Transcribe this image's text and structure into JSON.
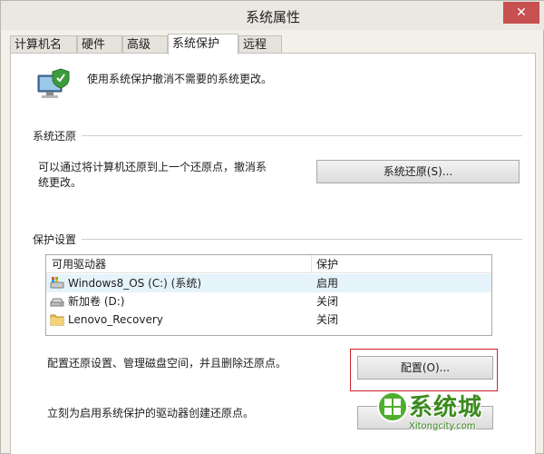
{
  "window": {
    "title": "系统属性",
    "close_glyph": "✕"
  },
  "tabs": [
    {
      "label": "计算机名"
    },
    {
      "label": "硬件"
    },
    {
      "label": "高级"
    },
    {
      "label": "系统保护",
      "active": true
    },
    {
      "label": "远程"
    }
  ],
  "intro": {
    "text": "使用系统保护撤消不需要的系统更改。",
    "icon": "computer-shield-icon"
  },
  "restore": {
    "group_title": "系统还原",
    "description_line1": "可以通过将计算机还原到上一个还原点，撤消系",
    "description_line2": "统更改。",
    "button_label": "系统还原(S)..."
  },
  "protection": {
    "group_title": "保护设置",
    "columns": [
      "可用驱动器",
      "保护"
    ],
    "drives": [
      {
        "name": "Windows8_OS (C:) (系统)",
        "status": "启用",
        "icon": "system-drive-icon",
        "selected": true
      },
      {
        "name": "新加卷 (D:)",
        "status": "关闭",
        "icon": "drive-icon"
      },
      {
        "name": "Lenovo_Recovery",
        "status": "关闭",
        "icon": "folder-icon"
      }
    ],
    "configure_text": "配置还原设置、管理磁盘空间，并且删除还原点。",
    "configure_button": "配置(O)...",
    "create_text": "立刻为启用系统保护的驱动器创建还原点。",
    "create_button": ""
  },
  "watermark": {
    "brand": "系统城",
    "url": "Xitongcity.com"
  },
  "colors": {
    "highlight": "#d0202a",
    "selected_row": "#e5f3fb",
    "watermark_green": "#3c8a1f"
  }
}
